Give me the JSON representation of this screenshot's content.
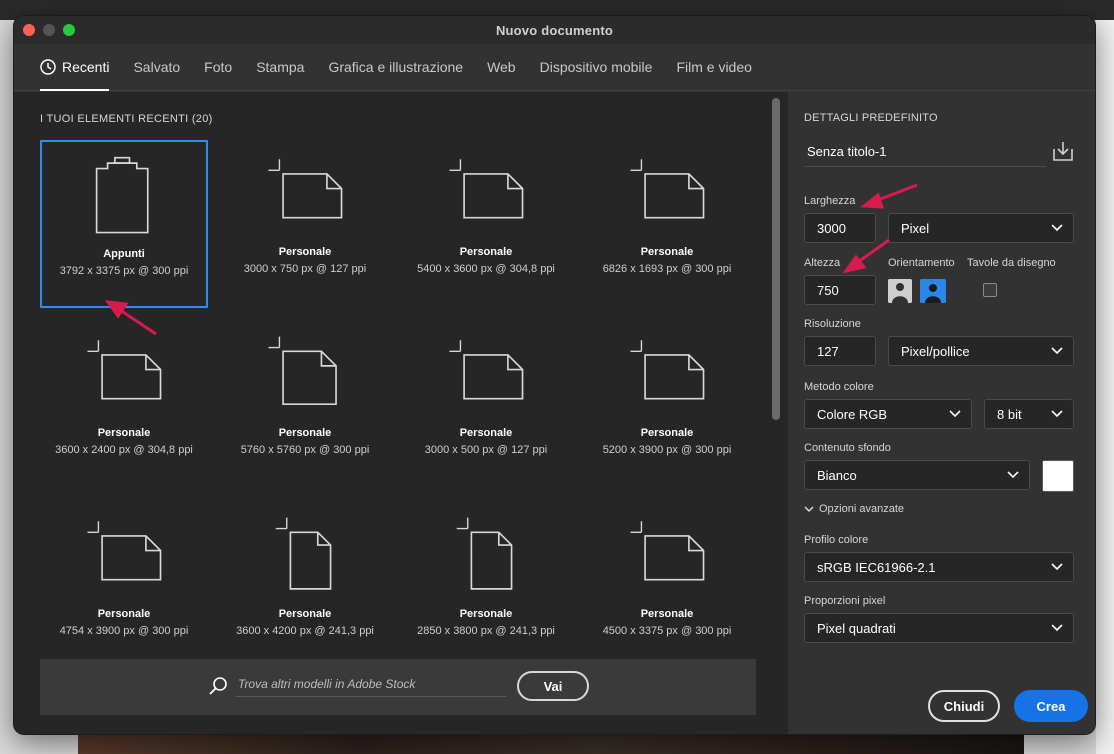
{
  "window": {
    "title": "Nuovo documento"
  },
  "tabs": [
    {
      "label": "Recenti",
      "active": true
    },
    {
      "label": "Salvato"
    },
    {
      "label": "Foto"
    },
    {
      "label": "Stampa"
    },
    {
      "label": "Grafica e illustrazione"
    },
    {
      "label": "Web"
    },
    {
      "label": "Dispositivo mobile"
    },
    {
      "label": "Film e video"
    }
  ],
  "recent": {
    "section_title": "I TUOI ELEMENTI RECENTI  (20)",
    "items": [
      {
        "name": "Appunti",
        "dims": "3792 x 3375 px @ 300 ppi",
        "icon": "clipboard-icon",
        "selected": true
      },
      {
        "name": "Personale",
        "dims": "3000 x 750 px @ 127 ppi",
        "icon": "document-landscape-icon"
      },
      {
        "name": "Personale",
        "dims": "5400 x 3600 px @ 304,8 ppi",
        "icon": "document-landscape-icon"
      },
      {
        "name": "Personale",
        "dims": "6826 x 1693 px @ 300 ppi",
        "icon": "document-landscape-icon"
      },
      {
        "name": "Personale",
        "dims": "3600 x 2400 px @ 304,8 ppi",
        "icon": "document-landscape-icon"
      },
      {
        "name": "Personale",
        "dims": "5760 x 5760 px @ 300 ppi",
        "icon": "document-square-icon"
      },
      {
        "name": "Personale",
        "dims": "3000 x 500 px @ 127 ppi",
        "icon": "document-landscape-icon"
      },
      {
        "name": "Personale",
        "dims": "5200 x 3900 px @ 300 ppi",
        "icon": "document-landscape-icon"
      },
      {
        "name": "Personale",
        "dims": "4754 x 3900 px @ 300 ppi",
        "icon": "document-landscape-icon"
      },
      {
        "name": "Personale",
        "dims": "3600 x 4200 px @ 241,3 ppi",
        "icon": "document-portrait-icon"
      },
      {
        "name": "Personale",
        "dims": "2850 x 3800 px @ 241,3 ppi",
        "icon": "document-portrait-icon"
      },
      {
        "name": "Personale",
        "dims": "4500 x 3375 px @ 300 ppi",
        "icon": "document-landscape-icon"
      }
    ]
  },
  "search": {
    "placeholder": "Trova altri modelli in Adobe Stock",
    "button": "Vai"
  },
  "details": {
    "title": "DETTAGLI PREDEFINITO",
    "preset_name": "Senza titolo-1",
    "width_label": "Larghezza",
    "width_value": "3000",
    "width_unit": "Pixel",
    "height_label": "Altezza",
    "height_value": "750",
    "orientation_label": "Orientamento",
    "artboards_label": "Tavole da disegno",
    "resolution_label": "Risoluzione",
    "resolution_value": "127",
    "resolution_unit": "Pixel/pollice",
    "color_mode_label": "Metodo colore",
    "color_mode_value": "Colore RGB",
    "bit_depth": "8 bit",
    "background_label": "Contenuto sfondo",
    "background_value": "Bianco",
    "background_color": "#ffffff",
    "advanced_label": "Opzioni avanzate",
    "profile_label": "Profilo colore",
    "profile_value": "sRGB IEC61966-2.1",
    "aspect_label": "Proporzioni pixel",
    "aspect_value": "Pixel quadrati"
  },
  "actions": {
    "close": "Chiudi",
    "create": "Crea"
  },
  "colors": {
    "accent": "#1473e6",
    "selection": "#2d8ceb",
    "annotation_arrow": "#d81b4f"
  }
}
